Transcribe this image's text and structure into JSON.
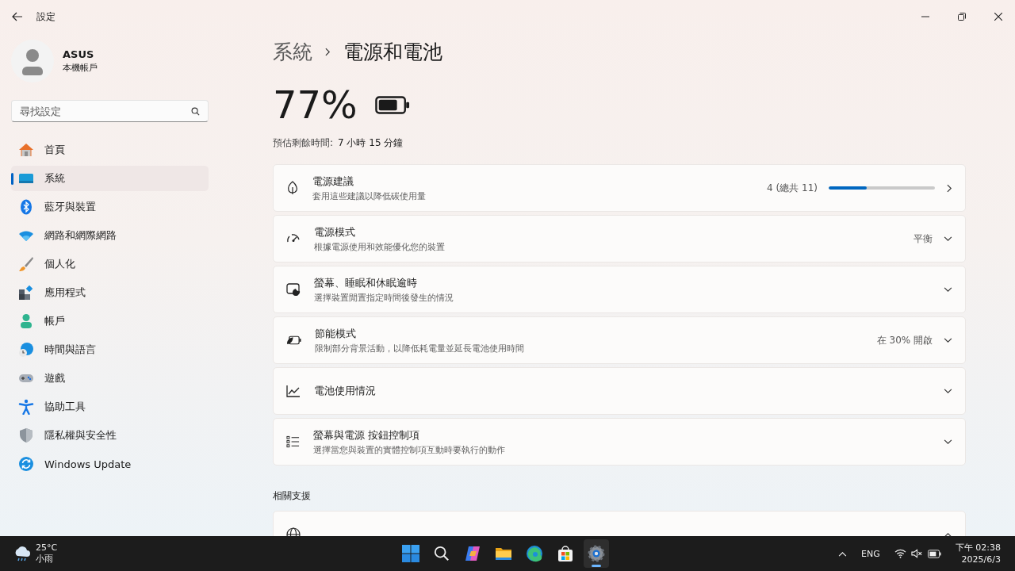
{
  "window": {
    "title": "設定"
  },
  "account": {
    "name": "ASUS",
    "type": "本機帳戶"
  },
  "search": {
    "placeholder": "尋找設定"
  },
  "nav": [
    {
      "label": "首頁",
      "kind": "home",
      "selected": false
    },
    {
      "label": "系統",
      "kind": "system",
      "selected": true
    },
    {
      "label": "藍牙與裝置",
      "kind": "bluetooth",
      "selected": false
    },
    {
      "label": "網路和網際網路",
      "kind": "wifi",
      "selected": false
    },
    {
      "label": "個人化",
      "kind": "brush",
      "selected": false
    },
    {
      "label": "應用程式",
      "kind": "apps",
      "selected": false
    },
    {
      "label": "帳戶",
      "kind": "person",
      "selected": false
    },
    {
      "label": "時間與語言",
      "kind": "globe",
      "selected": false
    },
    {
      "label": "遊戲",
      "kind": "gamepad",
      "selected": false
    },
    {
      "label": "協助工具",
      "kind": "accessibility",
      "selected": false
    },
    {
      "label": "隱私權與安全性",
      "kind": "shield",
      "selected": false
    },
    {
      "label": "Windows Update",
      "kind": "update",
      "selected": false
    }
  ],
  "breadcrumb": [
    "系統",
    "電源和電池"
  ],
  "battery": {
    "percent": "77%",
    "level": 0.77,
    "remaining_label": "預估剩餘時間:",
    "remaining_value": "7 小時 15 分鐘"
  },
  "cards": [
    {
      "kind": "link",
      "title": "電源建議",
      "subtitle": "套用這些建議以降低碳使用量",
      "value": "4 (總共 11)",
      "level": 0.36
    },
    {
      "kind": "expander",
      "title": "電源模式",
      "subtitle": "根據電源使用和效能優化您的裝置",
      "value": "平衡",
      "expanded": false
    },
    {
      "kind": "expander",
      "title": "螢幕、睡眠和休眠逾時",
      "subtitle": "選擇裝置閒置指定時間後發生的情況",
      "expanded": false
    },
    {
      "kind": "expander",
      "title": "節能模式",
      "subtitle": "限制部分背景活動，以降低耗電量並延長電池使用時間",
      "value": "在 30% 開啟",
      "expanded": false
    },
    {
      "kind": "expander",
      "title": "電池使用情況",
      "expanded": false
    },
    {
      "kind": "expander",
      "title": "螢幕與電源 按鈕控制項",
      "subtitle": "選擇當您與裝置的實體控制項互動時要執行的動作",
      "expanded": false
    }
  ],
  "related": {
    "heading": "相關支援",
    "cards": [
      {
        "kind": "expander",
        "expanded": true
      }
    ]
  },
  "taskbar": {
    "weather": {
      "temp": "25°C",
      "condition": "小雨"
    },
    "apps": [
      {
        "kind": "start",
        "selected": false
      },
      {
        "kind": "search",
        "selected": false
      },
      {
        "kind": "copilot",
        "selected": false
      },
      {
        "kind": "folder",
        "selected": false
      },
      {
        "kind": "edge",
        "selected": false
      },
      {
        "kind": "store",
        "selected": false
      },
      {
        "kind": "settings",
        "selected": true
      }
    ],
    "language": "ENG",
    "time": "下午 02:38",
    "date": "2025/6/3"
  }
}
